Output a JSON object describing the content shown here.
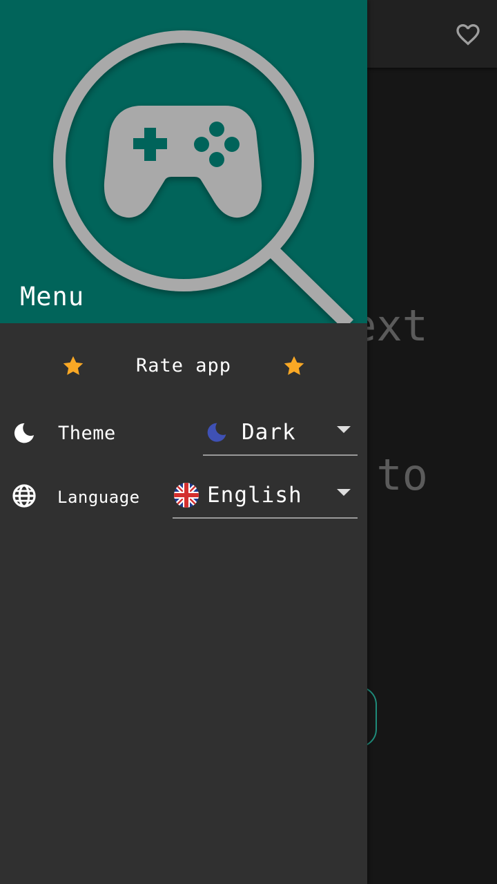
{
  "background_app": {
    "body_text_lines": [
      "ext",
      "to"
    ],
    "favorite_icon": "heart-outline-icon"
  },
  "drawer": {
    "header": {
      "title": "Menu",
      "logo_icon": "gamepad-search-icon"
    },
    "rate": {
      "label": "Rate app",
      "star_icon": "star-icon"
    },
    "theme": {
      "label": "Theme",
      "icon": "moon-icon",
      "selected": "Dark",
      "selected_icon": "moon-icon"
    },
    "language": {
      "label": "Language",
      "icon": "globe-icon",
      "selected": "English",
      "selected_icon": "uk-flag-icon"
    }
  },
  "colors": {
    "header_bg": "#01645a",
    "drawer_bg": "#303030",
    "star": "#f9a825",
    "theme_moon": "#3f51b5",
    "accent_outline": "#1f8c7b"
  }
}
